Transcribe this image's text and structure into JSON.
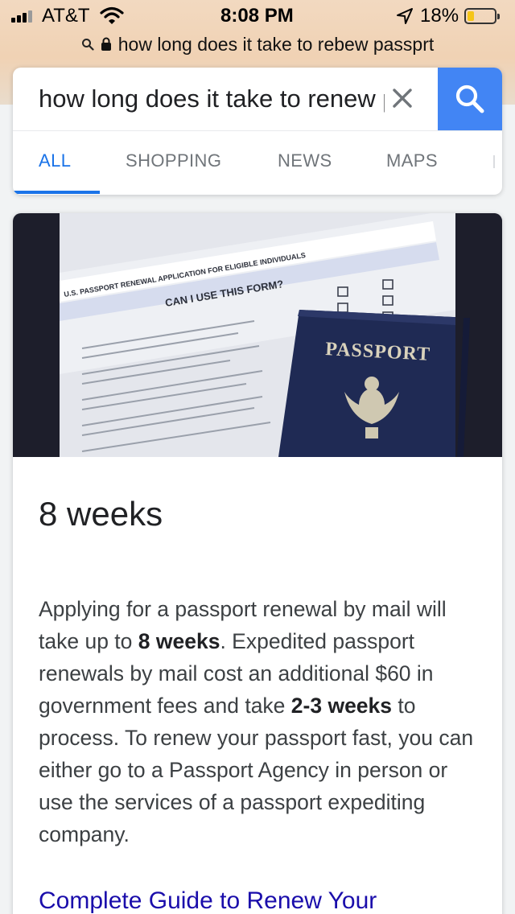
{
  "status_bar": {
    "carrier": "AT&T",
    "time": "8:08 PM",
    "battery_percent": "18%",
    "icons": [
      "signal-bars-icon",
      "wifi-icon",
      "location-arrow-icon",
      "battery-icon"
    ]
  },
  "url_bar": {
    "text": "how long does it take to rebew passprt",
    "icons": [
      "search-icon",
      "lock-icon"
    ]
  },
  "search": {
    "query": "how long does it take to renew passport",
    "icons": [
      "close-icon",
      "search-icon"
    ],
    "accent_color": "#4285f4"
  },
  "tabs": [
    {
      "label": "ALL",
      "active": true
    },
    {
      "label": "SHOPPING",
      "active": false
    },
    {
      "label": "NEWS",
      "active": false
    },
    {
      "label": "MAPS",
      "active": false
    }
  ],
  "answer": {
    "image": {
      "form_title": "U.S. PASSPORT RENEWAL APPLICATION FOR ELIGIBLE INDIVIDUALS",
      "form_subtitle": "CAN I USE THIS FORM?",
      "passport_label": "PASSPORT"
    },
    "title": "8 weeks",
    "text_parts": [
      {
        "text": "Applying for a passport renewal by mail will take up to ",
        "bold": false
      },
      {
        "text": "8 weeks",
        "bold": true
      },
      {
        "text": ". Expedited passport renewals by mail cost an additional $60 in government fees and take ",
        "bold": false
      },
      {
        "text": "2-3 weeks",
        "bold": true
      },
      {
        "text": " to process. To renew your passport fast, you can either go to a Passport Agency in person or use the services of a passport expediting company.",
        "bold": false
      }
    ],
    "source_link": "Complete Guide to Renew Your",
    "link_color": "#1a0dab"
  }
}
